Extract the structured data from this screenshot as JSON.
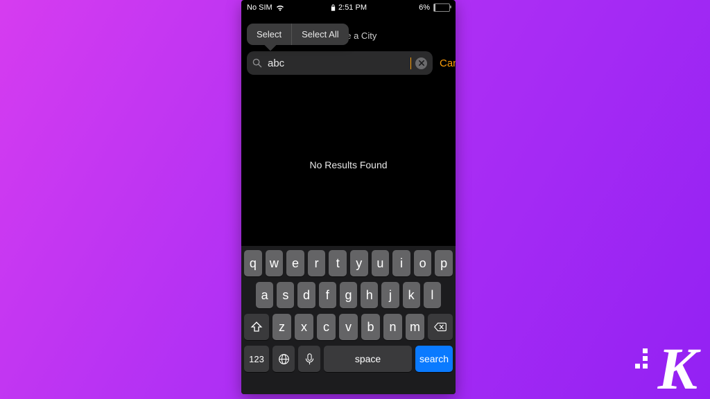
{
  "status": {
    "carrier": "No SIM",
    "time": "2:51 PM",
    "battery_pct": "6%",
    "battery_fill": 8
  },
  "context_menu": {
    "select": "Select",
    "select_all": "Select All"
  },
  "header": {
    "subtitle": "Choose a City"
  },
  "search": {
    "value": "abc",
    "cancel": "Cancel"
  },
  "body": {
    "empty": "No Results Found"
  },
  "keyboard": {
    "row1": [
      "q",
      "w",
      "e",
      "r",
      "t",
      "y",
      "u",
      "i",
      "o",
      "p"
    ],
    "row2": [
      "a",
      "s",
      "d",
      "f",
      "g",
      "h",
      "j",
      "k",
      "l"
    ],
    "row3": [
      "z",
      "x",
      "c",
      "v",
      "b",
      "n",
      "m"
    ],
    "numbers": "123",
    "space": "space",
    "search": "search"
  },
  "watermark": {
    "letter": "K"
  }
}
